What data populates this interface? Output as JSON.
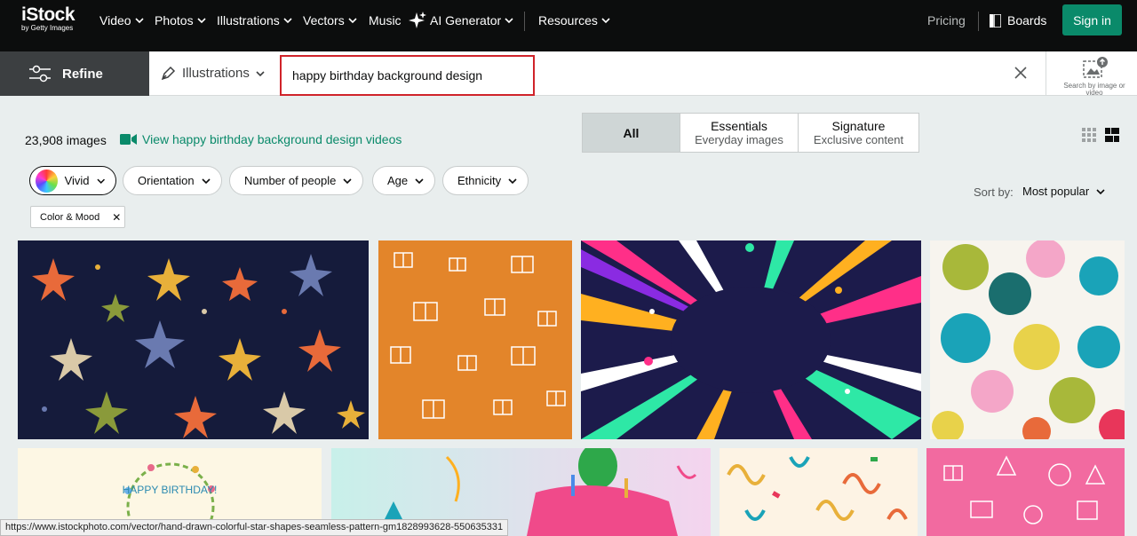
{
  "brand": {
    "name": "iStock",
    "tagline": "by Getty Images"
  },
  "nav": {
    "items": [
      {
        "label": "Video",
        "dropdown": true
      },
      {
        "label": "Photos",
        "dropdown": true
      },
      {
        "label": "Illustrations",
        "dropdown": true
      },
      {
        "label": "Vectors",
        "dropdown": true
      },
      {
        "label": "Music",
        "dropdown": false
      },
      {
        "label": "AI Generator",
        "dropdown": true
      },
      {
        "label": "Resources",
        "dropdown": true
      }
    ],
    "pricing": "Pricing",
    "boards": "Boards",
    "signin": "Sign in"
  },
  "search": {
    "refine": "Refine",
    "type": "Illustrations",
    "query": "happy birthday background design",
    "image_search": "Search by image or video"
  },
  "results": {
    "count": "23,908 images",
    "video_link": "View happy birthday background design videos",
    "tabs": [
      {
        "title": "All",
        "sub": ""
      },
      {
        "title": "Essentials",
        "sub": "Everyday images"
      },
      {
        "title": "Signature",
        "sub": "Exclusive content"
      }
    ]
  },
  "filters": {
    "items": [
      "Vivid",
      "Orientation",
      "Number of people",
      "Age",
      "Ethnicity"
    ],
    "sort_label": "Sort by:",
    "sort_value": "Most popular",
    "chip": "Color & Mood"
  },
  "images": [
    {
      "name": "Star shapes seamless pattern"
    },
    {
      "name": "Gift boxes pattern orange"
    },
    {
      "name": "Burst confetti background"
    },
    {
      "name": "Balloons pattern"
    },
    {
      "name": "Happy Birthday wreath card",
      "text": "HAPPY BIRTHDAY!"
    },
    {
      "name": "Birthday cake balloons"
    },
    {
      "name": "Confetti streamers"
    },
    {
      "name": "Pink birthday doodles"
    }
  ],
  "status_url": "https://www.istockphoto.com/vector/hand-drawn-colorful-star-shapes-seamless-pattern-gm1828993628-550635331",
  "colors": {
    "accent": "#0a8a6a",
    "nav_bg": "#0c0d0d",
    "highlight": "#d0232a"
  }
}
